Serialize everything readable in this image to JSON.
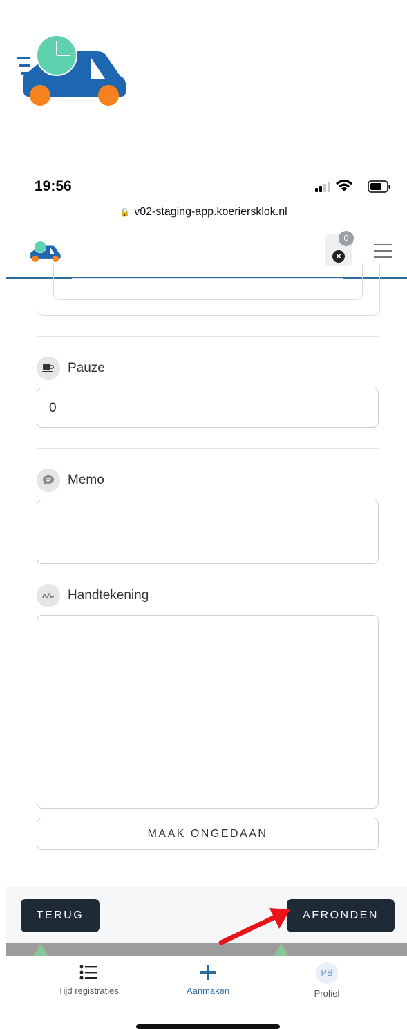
{
  "status_bar": {
    "time": "19:56"
  },
  "browser": {
    "url": "v02-staging-app.koeriersklok.nl"
  },
  "header": {
    "notification_count": "0"
  },
  "form": {
    "pauze_label": "Pauze",
    "pauze_value": "0",
    "memo_label": "Memo",
    "memo_value": "",
    "signature_label": "Handtekening",
    "undo_button": "MAAK ONGEDAAN"
  },
  "actions": {
    "back_button": "TERUG",
    "finish_button": "AFRONDEN"
  },
  "tabs": [
    {
      "label": "Tijd registraties",
      "icon": "list-icon"
    },
    {
      "label": "Aanmaken",
      "icon": "plus-icon",
      "active": true
    },
    {
      "label": "Profiel",
      "icon": "avatar",
      "initials": "PB"
    }
  ],
  "colors": {
    "brand_blue": "#2d6b9e",
    "clock_green": "#5fd1ae",
    "wheel_orange": "#f5821f",
    "dark_button": "#1f2a37",
    "annotation_red": "#e8141a"
  }
}
